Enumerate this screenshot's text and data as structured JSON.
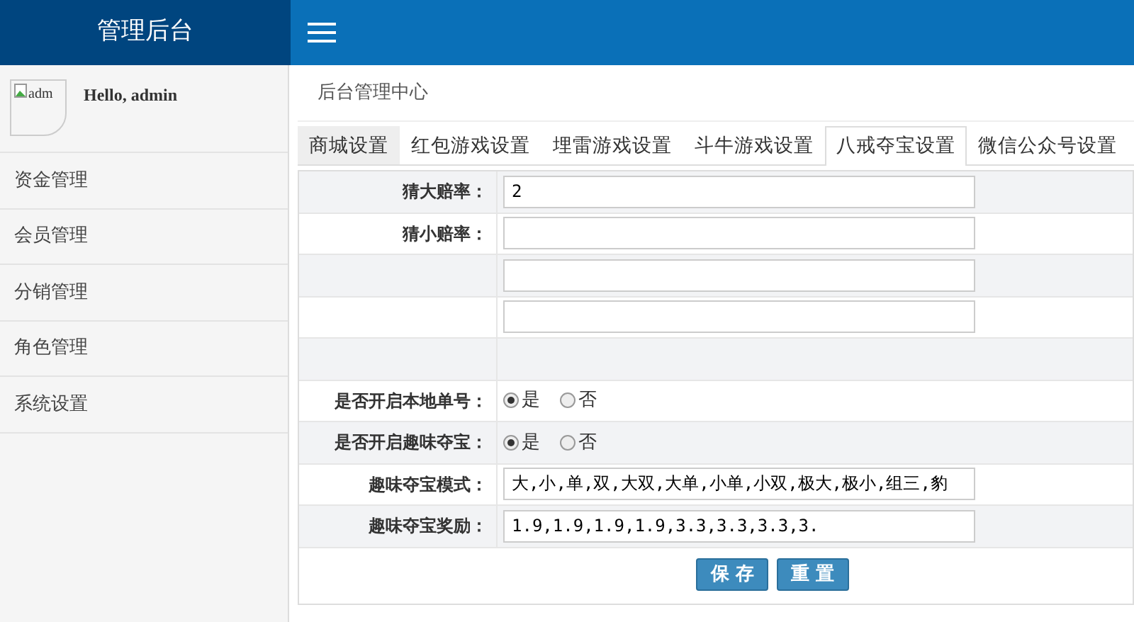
{
  "brand": "管理后台",
  "user": {
    "avatar_alt": "adm",
    "greeting": "Hello, admin"
  },
  "sidebar": {
    "items": [
      {
        "label": "资金管理"
      },
      {
        "label": "会员管理"
      },
      {
        "label": "分销管理"
      },
      {
        "label": "角色管理"
      },
      {
        "label": "系统设置"
      }
    ]
  },
  "breadcrumb": "后台管理中心",
  "tabs": [
    {
      "label": "商城设置",
      "selected": false
    },
    {
      "label": "红包游戏设置",
      "selected": false
    },
    {
      "label": "埋雷游戏设置",
      "selected": false
    },
    {
      "label": "斗牛游戏设置",
      "selected": false
    },
    {
      "label": "八戒夺宝设置",
      "selected": true
    },
    {
      "label": "微信公众号设置",
      "selected": false
    }
  ],
  "form": {
    "rows": [
      {
        "kind": "text",
        "label": "猜大赔率：",
        "value": "2"
      },
      {
        "kind": "text",
        "label": "猜小赔率："
      },
      {
        "kind": "text"
      },
      {
        "kind": "text"
      },
      {
        "kind": "blank"
      },
      {
        "kind": "radio",
        "label": "是否开启本地单号：",
        "options": [
          {
            "label": "是",
            "selected": true
          },
          {
            "label": "否",
            "selected": false
          }
        ]
      },
      {
        "kind": "radio",
        "label": "是否开启趣味夺宝：",
        "options": [
          {
            "label": "是",
            "selected": true
          },
          {
            "label": "否",
            "selected": false
          }
        ]
      },
      {
        "kind": "text",
        "label": "趣味夺宝模式：",
        "value": "大,小,单,双,大双,大单,小单,小双,极大,极小,组三,豹"
      },
      {
        "kind": "text",
        "label": "趣味夺宝奖励：",
        "value": "1.9,1.9,1.9,1.9,3.3,3.3,3.3,3."
      }
    ],
    "buttons": [
      "保 存",
      "重 置"
    ]
  }
}
